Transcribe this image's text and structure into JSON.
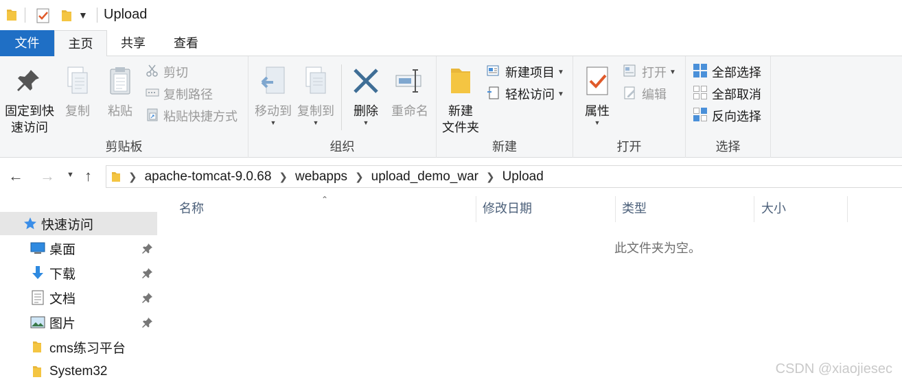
{
  "window": {
    "title": "Upload"
  },
  "tabs": {
    "file": "文件",
    "home": "主页",
    "share": "共享",
    "view": "查看"
  },
  "ribbon": {
    "clipboard": {
      "label": "剪贴板",
      "pin_quick_line1": "固定到快",
      "pin_quick_line2": "速访问",
      "copy": "复制",
      "paste": "粘贴",
      "cut": "剪切",
      "copy_path": "复制路径",
      "paste_shortcut": "粘贴快捷方式"
    },
    "organize": {
      "label": "组织",
      "move_to": "移动到",
      "copy_to": "复制到",
      "delete": "删除",
      "rename": "重命名"
    },
    "new": {
      "label": "新建",
      "new_folder_line1": "新建",
      "new_folder_line2": "文件夹",
      "new_item": "新建项目",
      "easy_access": "轻松访问"
    },
    "open": {
      "label": "打开",
      "properties": "属性",
      "open": "打开",
      "edit": "编辑"
    },
    "select": {
      "label": "选择",
      "select_all": "全部选择",
      "select_none": "全部取消",
      "invert": "反向选择"
    }
  },
  "breadcrumb": [
    "apache-tomcat-9.0.68",
    "webapps",
    "upload_demo_war",
    "Upload"
  ],
  "sidebar": {
    "items": [
      {
        "label": "快速访问"
      },
      {
        "label": "桌面"
      },
      {
        "label": "下载"
      },
      {
        "label": "文档"
      },
      {
        "label": "图片"
      },
      {
        "label": "cms练习平台"
      },
      {
        "label": "System32"
      }
    ]
  },
  "columns": {
    "name": "名称",
    "modified": "修改日期",
    "type": "类型",
    "size": "大小"
  },
  "empty_message": "此文件夹为空。",
  "watermark": "CSDN @xiaojiesec",
  "colors": {
    "file_tab": "#1f6fc5",
    "ribbon_bg": "#f5f6f7",
    "folder": "#f4c542",
    "selected": "#e6e6e6"
  }
}
